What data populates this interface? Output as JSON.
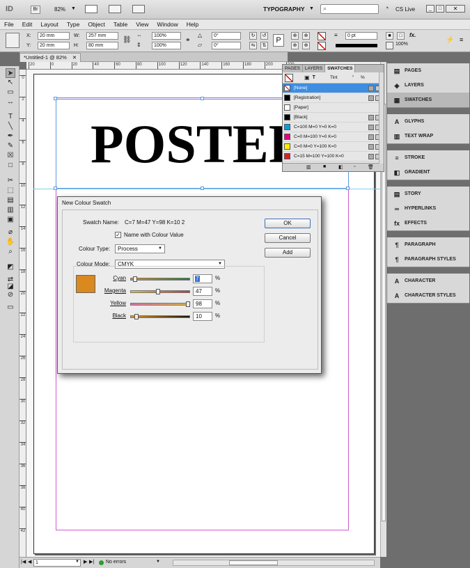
{
  "app": {
    "logo": "ID",
    "bridge_label": "Br",
    "zoom": "82%",
    "workspace": "TYPOGRAPHY",
    "search_placeholder": "",
    "cslive": "CS Live"
  },
  "menu": [
    "File",
    "Edit",
    "Layout",
    "Type",
    "Object",
    "Table",
    "View",
    "Window",
    "Help"
  ],
  "control": {
    "x_label": "X:",
    "x_value": "20 mm",
    "y_label": "Y:",
    "y_value": "20 mm",
    "w_label": "W:",
    "w_value": "257 mm",
    "h_label": "H:",
    "h_value": "80 mm",
    "scale_x": "100%",
    "scale_y": "100%",
    "rotate": "0°",
    "shear": "0°",
    "stroke_weight": "0 pt",
    "opacity": "100%"
  },
  "document": {
    "tab_title": "*Untitled-1 @ 82%",
    "heading": "POSTER"
  },
  "ruler": {
    "h_ticks": [
      "20",
      "0",
      "20",
      "40",
      "60",
      "80",
      "100",
      "120",
      "140",
      "160",
      "180",
      "200",
      "220"
    ],
    "v_ticks": [
      "0",
      "2",
      "4",
      "6",
      "8",
      "10",
      "12",
      "14",
      "16",
      "18",
      "20",
      "22",
      "24",
      "26",
      "28",
      "30",
      "32",
      "34",
      "36",
      "38",
      "40",
      "42"
    ]
  },
  "status": {
    "page": "1",
    "errors": "No errors"
  },
  "swatches_panel": {
    "tabs": [
      "PAGES",
      "LAYERS",
      "SWATCHES"
    ],
    "tint_label": "Tint",
    "percent_label": "%",
    "items": [
      {
        "name": "[None]",
        "color": "#ffffff"
      },
      {
        "name": "[Registration]",
        "color": "#000000"
      },
      {
        "name": "[Paper]",
        "color": "#ffffff"
      },
      {
        "name": "[Black]",
        "color": "#000000"
      },
      {
        "name": "C=100 M=0 Y=0 K=0",
        "color": "#00a0e6"
      },
      {
        "name": "C=0 M=100 Y=0 K=0",
        "color": "#e4007f"
      },
      {
        "name": "C=0 M=0 Y=100 K=0",
        "color": "#fff100"
      },
      {
        "name": "C=15 M=100 Y=100 K=0",
        "color": "#d2232a"
      }
    ]
  },
  "right_panel": {
    "groups": [
      [
        {
          "label": "PAGES",
          "icon": "pages-icon",
          "glyph": "▤"
        },
        {
          "label": "LAYERS",
          "icon": "layers-icon",
          "glyph": "◈"
        },
        {
          "label": "SWATCHES",
          "icon": "swatches-icon",
          "glyph": "▦"
        }
      ],
      [
        {
          "label": "GLYPHS",
          "icon": "glyphs-icon",
          "glyph": "A"
        },
        {
          "label": "TEXT WRAP",
          "icon": "text-wrap-icon",
          "glyph": "▥"
        }
      ],
      [
        {
          "label": "STROKE",
          "icon": "stroke-icon",
          "glyph": "≡"
        },
        {
          "label": "GRADIENT",
          "icon": "gradient-icon",
          "glyph": "◧"
        }
      ],
      [
        {
          "label": "STORY",
          "icon": "story-icon",
          "glyph": "▤"
        },
        {
          "label": "HYPERLINKS",
          "icon": "hyperlinks-icon",
          "glyph": "∞"
        },
        {
          "label": "EFFECTS",
          "icon": "effects-icon",
          "glyph": "fx"
        }
      ],
      [
        {
          "label": "PARAGRAPH",
          "icon": "paragraph-icon",
          "glyph": "¶"
        },
        {
          "label": "PARAGRAPH STYLES",
          "icon": "paragraph-styles-icon",
          "glyph": "¶"
        }
      ],
      [
        {
          "label": "CHARACTER",
          "icon": "character-icon",
          "glyph": "A"
        },
        {
          "label": "CHARACTER STYLES",
          "icon": "character-styles-icon",
          "glyph": "A"
        }
      ]
    ]
  },
  "dialog": {
    "title": "New Colour Swatch",
    "swatch_name_label": "Swatch Name:",
    "swatch_name_value": "C=7 M=47 Y=98 K=10 2",
    "name_with_value_label": "Name with Colour Value",
    "colour_type_label": "Colour Type:",
    "colour_type_value": "Process",
    "colour_mode_label": "Colour Mode:",
    "colour_mode_value": "CMYK",
    "preview_color": "#d9891e",
    "ok": "OK",
    "cancel": "Cancel",
    "add": "Add",
    "percent": "%",
    "channels": [
      {
        "label": "Cyan",
        "value": "7",
        "fraction": 0.07,
        "grad": "linear-gradient(90deg,#d9891e,#1b7f3a)"
      },
      {
        "label": "Magenta",
        "value": "47",
        "fraction": 0.47,
        "grad": "linear-gradient(90deg,#e7c51c,#c8323a)"
      },
      {
        "label": "Yellow",
        "value": "98",
        "fraction": 0.98,
        "grad": "linear-gradient(90deg,#dd6fa6,#e0b63a)"
      },
      {
        "label": "Black",
        "value": "10",
        "fraction": 0.1,
        "grad": "linear-gradient(90deg,#e39521,#1a1208)"
      }
    ]
  }
}
